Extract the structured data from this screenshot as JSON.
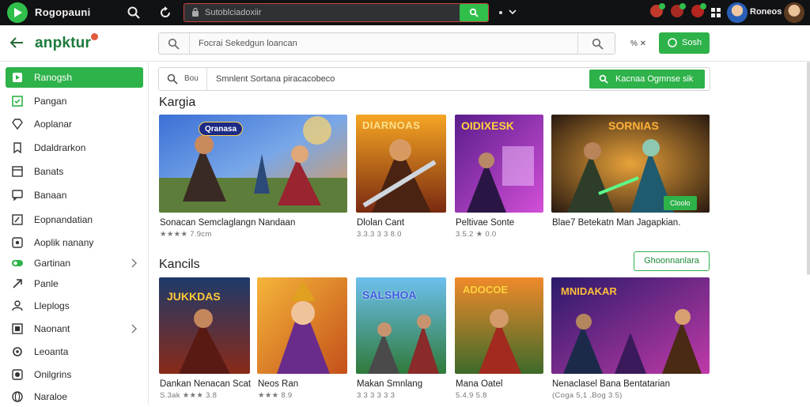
{
  "topbar": {
    "title": "Rogopauni",
    "address": "Sutoblciadoxiir",
    "user": "Roneos"
  },
  "header": {
    "brand": "anpktur",
    "search_text": "Focrai Sekedgun  loancan",
    "misc": "% ✕",
    "button_label": "Sosh"
  },
  "sidebar": {
    "items": [
      {
        "label": "Ranogsh",
        "icon": "home-icon"
      },
      {
        "label": "Pangan",
        "icon": "check-square-icon"
      },
      {
        "label": "Aoplanar",
        "icon": "diamond-icon"
      },
      {
        "label": "Ddaldrarkon",
        "icon": "bookmark-icon"
      },
      {
        "label": "Banats",
        "icon": "window-icon"
      },
      {
        "label": "Banaan",
        "icon": "chat-icon"
      },
      {
        "label": "Eopnandatian",
        "icon": "pencil-icon"
      },
      {
        "label": "Aoplik nanany",
        "icon": "square-icon"
      },
      {
        "label": "Gartinan",
        "icon": "toggle-icon"
      },
      {
        "label": "Panle",
        "icon": "arrow-up-right-icon"
      },
      {
        "label": "Lleplogs",
        "icon": "person-icon"
      },
      {
        "label": "Naonant",
        "icon": "grid-box-icon"
      },
      {
        "label": "Leoanta",
        "icon": "gear-icon"
      },
      {
        "label": "Onilgrins",
        "icon": "phone-icon"
      },
      {
        "label": "Naraloe",
        "icon": "globe-icon"
      }
    ]
  },
  "main": {
    "search_filter": "Bou",
    "search_text": "Smnlent Sortana piracacobeco",
    "search_button": "Kacnaa Ogmnse sik"
  },
  "sections": [
    {
      "title": "Kargia",
      "cards": [
        {
          "name": "Sonacan Semclaglangn Nandaan",
          "meta": "★★★★ 7.9cm",
          "tag": "Qranasa",
          "badge": "",
          "label": ""
        },
        {
          "name": "Dlolan Cant",
          "meta": "3.3.3 3 3 8.0",
          "tag": "",
          "badge": "",
          "label": "DIARNOAS"
        },
        {
          "name": "Peltivae Sonte",
          "meta": "3.5.2 ★ 0.0",
          "tag": "",
          "badge": "",
          "label": "OIDIXESK"
        },
        {
          "name": "Blae7 Betekatn Man Jagapkian.",
          "meta": "",
          "tag": "",
          "badge": "Cloolo",
          "label": "SORNIAS"
        }
      ]
    },
    {
      "title": "Kancils",
      "button": "Ghoonnanlara",
      "cards": [
        {
          "name": "Dankan Nenacan Scat",
          "meta": "S.3ak ★★★ 3.8",
          "tag": "",
          "badge": "",
          "label": "JUKKDAS"
        },
        {
          "name": "Neos Ran",
          "meta": "★★★ 8.9",
          "tag": "",
          "badge": "",
          "label": ""
        },
        {
          "name": "Makan Smnlang",
          "meta": "3 3 3 3 3 3",
          "tag": "",
          "badge": "",
          "label": "SALSHOA"
        },
        {
          "name": "Mana Oatel",
          "meta": "5.4.9 5.8",
          "tag": "",
          "badge": "",
          "label": "ADOCOE"
        },
        {
          "name": "Nenaclasel Bana Bentatarian",
          "meta": "(Coga 5,1 ,Bog 3.5)",
          "tag": "",
          "badge": "",
          "label": "MNIDAKAR"
        }
      ]
    }
  ],
  "colors": {
    "accent": "#2eb24a",
    "topbar": "#111214",
    "brand": "#1d7a3a"
  }
}
